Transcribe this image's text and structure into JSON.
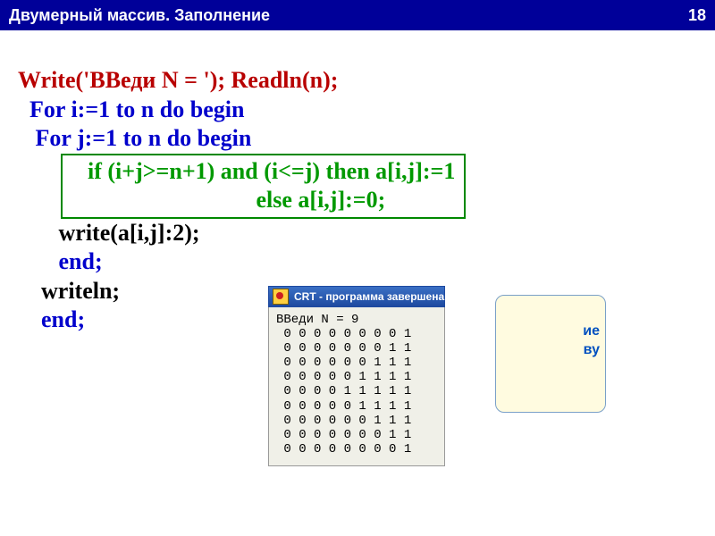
{
  "titlebar": {
    "title": "Двумерный массив. Заполнение",
    "page": "18"
  },
  "code": {
    "l1a": "Write('ВВеди N = '); ",
    "l1b": "Readln(n);",
    "l2a": "  For i:=1 to n do ",
    "l2b": "begin",
    "l3a": "   For j:=1 to n do ",
    "l3b": "begin",
    "l4": "    if (i+j>=n+1) and (i<=j) then a[i,j]:=1",
    "l5": "                                 else a[i,j]:=0;",
    "l6": "       write(a[i,j]:2);",
    "l7": "       end;",
    "l8": "    writeln;",
    "l9": "    end;"
  },
  "console": {
    "title": "CRT - программа завершена",
    "prompt": "ВВеди N = 9",
    "rows": [
      " 0 0 0 0 0 0 0 0 1",
      " 0 0 0 0 0 0 0 1 1",
      " 0 0 0 0 0 0 1 1 1",
      " 0 0 0 0 0 1 1 1 1",
      " 0 0 0 0 1 1 1 1 1",
      " 0 0 0 0 0 1 1 1 1",
      " 0 0 0 0 0 0 1 1 1",
      " 0 0 0 0 0 0 0 1 1",
      " 0 0 0 0 0 0 0 0 1"
    ]
  },
  "hint": {
    "l1": "ие",
    "l2": "ву"
  }
}
